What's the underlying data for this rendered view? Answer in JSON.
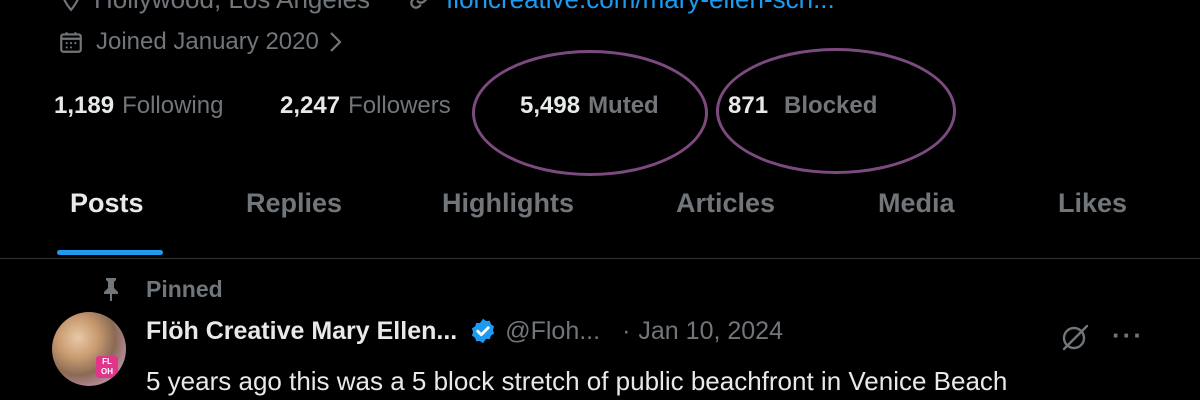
{
  "profile": {
    "location": "Hollywood, Los Angeles",
    "website": "flohcreative.com/mary-ellen-sch...",
    "joined": "Joined January 2020",
    "stats": {
      "following_count": "1,189",
      "following_label": "Following",
      "followers_count": "2,247",
      "followers_label": "Followers",
      "muted_count": "5,498",
      "muted_label": "Muted",
      "blocked_count": "871",
      "blocked_label": "Blocked"
    }
  },
  "tabs": [
    {
      "label": "Posts",
      "active": true
    },
    {
      "label": "Replies"
    },
    {
      "label": "Highlights"
    },
    {
      "label": "Articles"
    },
    {
      "label": "Media"
    },
    {
      "label": "Likes"
    }
  ],
  "pinned_post": {
    "pinned_label": "Pinned",
    "author_name": "Flöh Creative Mary Ellen...",
    "handle": "@Floh...",
    "separator": "·",
    "date": "Jan 10, 2024",
    "text": "5 years ago this was a 5 block stretch of public beachfront in Venice Beach",
    "avatar_badge": "FL\nOH"
  },
  "colors": {
    "background": "#000000",
    "text_primary": "#e7e9ea",
    "text_secondary": "#71767b",
    "accent": "#1d9bf0",
    "annotation_ring": "#7d4a80"
  }
}
